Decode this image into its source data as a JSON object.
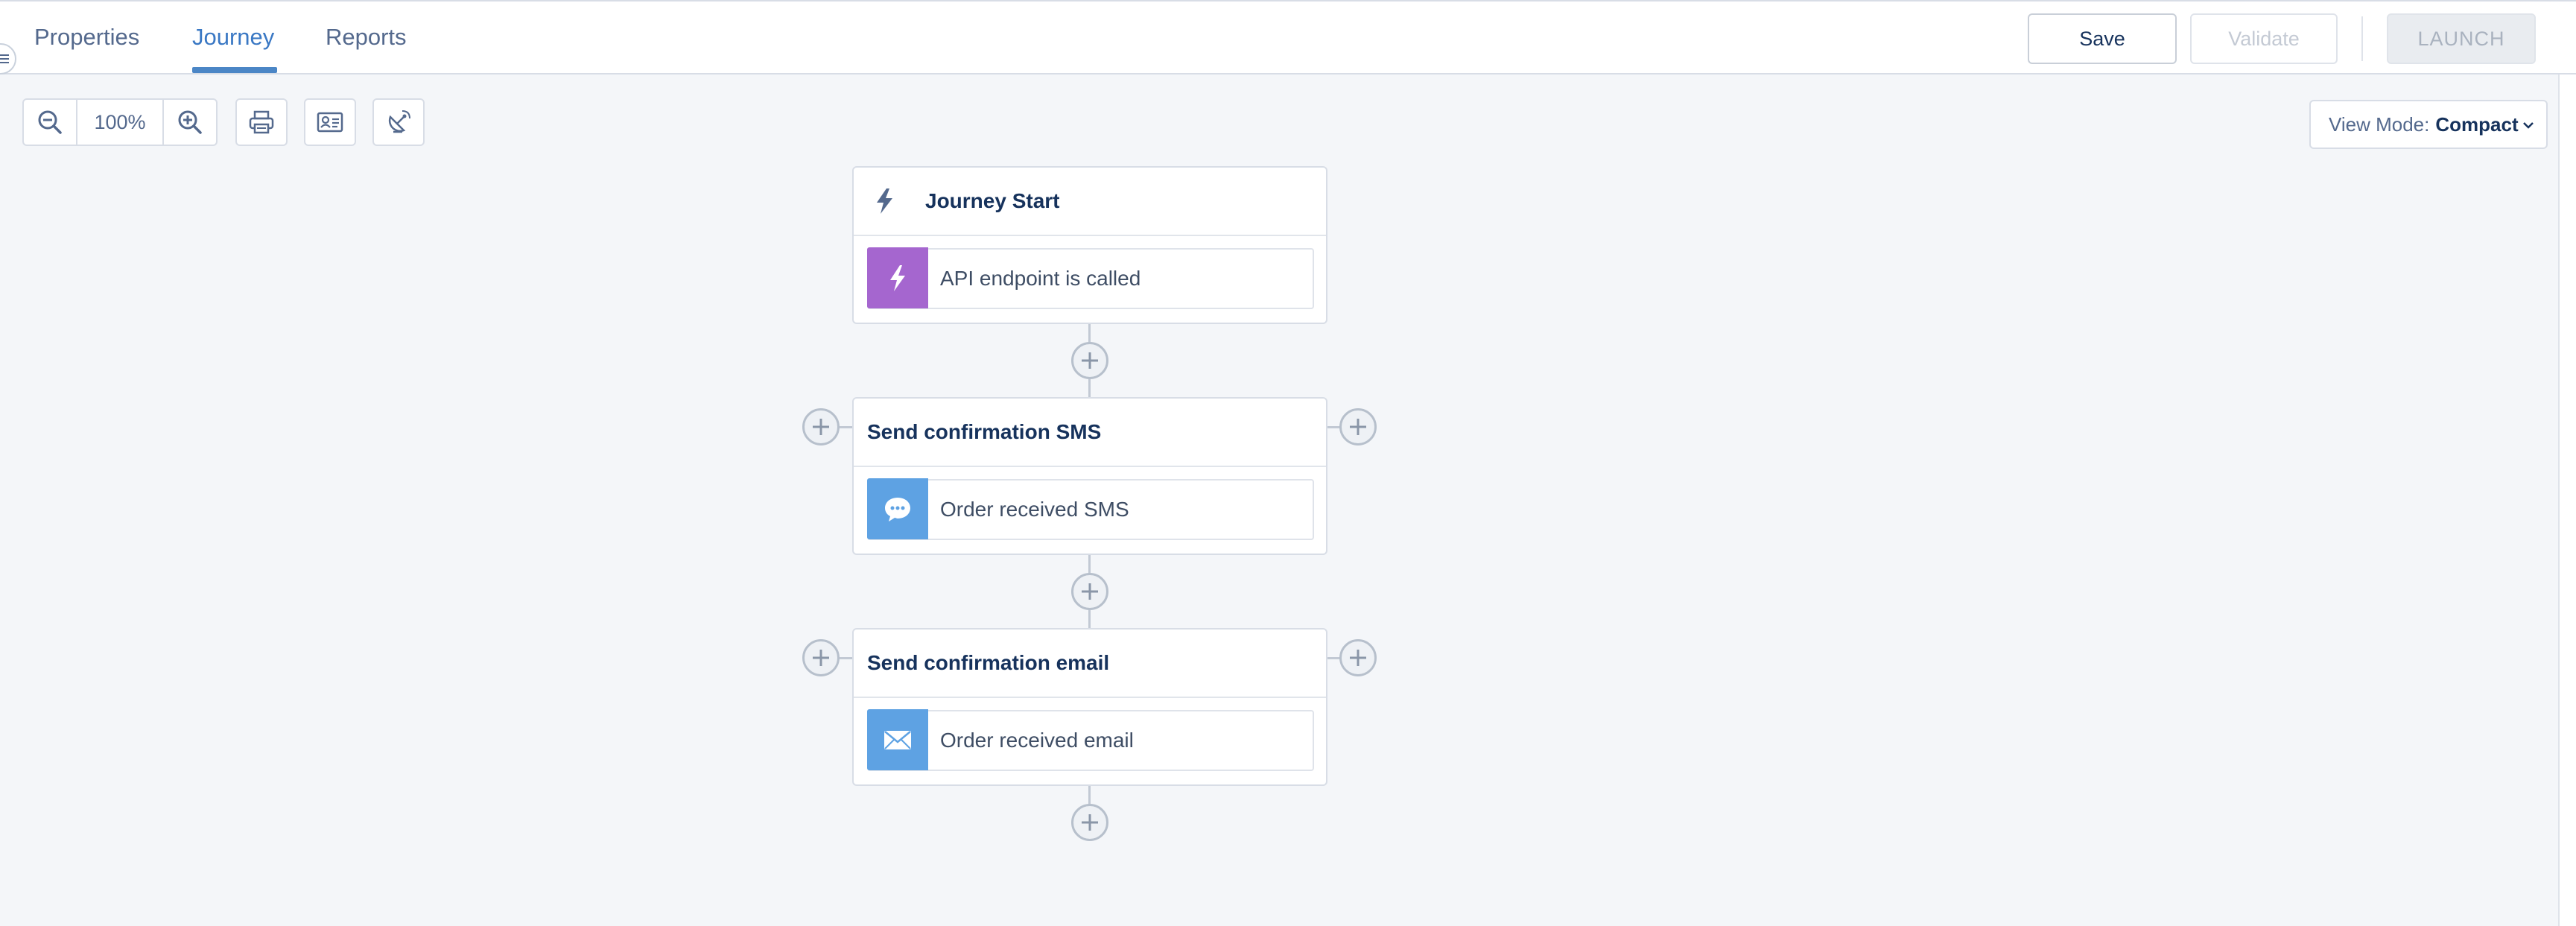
{
  "tabs": [
    {
      "label": "Properties",
      "active": false
    },
    {
      "label": "Journey",
      "active": true
    },
    {
      "label": "Reports",
      "active": false
    }
  ],
  "actions": {
    "save_label": "Save",
    "validate_label": "Validate",
    "launch_label": "LAUNCH"
  },
  "toolbar": {
    "zoom_level": "100%",
    "zoom_out_icon": "zoom-out-icon",
    "zoom_in_icon": "zoom-in-icon",
    "print_icon": "print-icon",
    "contact_card_icon": "contact-card-icon",
    "satellite_icon": "satellite-icon"
  },
  "view_mode": {
    "label": "View Mode:",
    "value": "Compact"
  },
  "journey": {
    "start": {
      "title": "Journey Start",
      "activity_label": "API endpoint is called",
      "activity_icon": "lightning-icon",
      "activity_color": "#a566cf"
    },
    "steps": [
      {
        "title": "Send confirmation SMS",
        "activity_label": "Order received SMS",
        "activity_icon": "chat-bubble-icon",
        "activity_color": "#5ea2e3"
      },
      {
        "title": "Send confirmation email",
        "activity_label": "Order received email",
        "activity_icon": "envelope-icon",
        "activity_color": "#5ea2e3"
      }
    ]
  },
  "colors": {
    "accent": "#3a78c4",
    "start_activity": "#a566cf",
    "message_activity": "#5ea2e3",
    "canvas_background": "#f4f6f9"
  }
}
